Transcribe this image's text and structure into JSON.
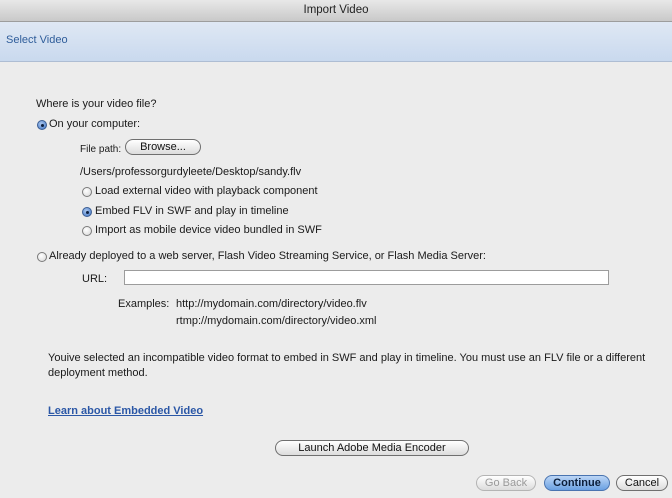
{
  "window": {
    "title": "Import Video"
  },
  "header": {
    "title": "Select Video"
  },
  "form": {
    "question": "Where is your video file?",
    "on_computer": {
      "label": "On your computer:",
      "selected": true
    },
    "file_path": {
      "label": "File path:",
      "browse_label": "Browse...",
      "value": "/Users/professorgurdyleete/Desktop/sandy.flv"
    },
    "suboptions": [
      {
        "label": "Load external video with playback component",
        "selected": false
      },
      {
        "label": "Embed FLV in SWF and play in timeline",
        "selected": true
      },
      {
        "label": "Import as mobile device video bundled in SWF",
        "selected": false
      }
    ],
    "deployed": {
      "label": "Already deployed to a web server, Flash Video Streaming Service, or Flash Media Server:",
      "selected": false
    },
    "url": {
      "label": "URL:",
      "value": ""
    },
    "examples": {
      "label": "Examples:",
      "line1": "http://mydomain.com/directory/video.flv",
      "line2": "rtmp://mydomain.com/directory/video.xml"
    }
  },
  "message": {
    "line1": "Youive selected an incompatible video format to embed in SWF and play in timeline. You must use an FLV file or a different",
    "line2": "deployment method."
  },
  "learn_link": "Learn about Embedded Video",
  "buttons": {
    "launch_encoder": "Launch Adobe Media Encoder",
    "go_back": "Go Back",
    "continue": "Continue",
    "cancel": "Cancel"
  }
}
